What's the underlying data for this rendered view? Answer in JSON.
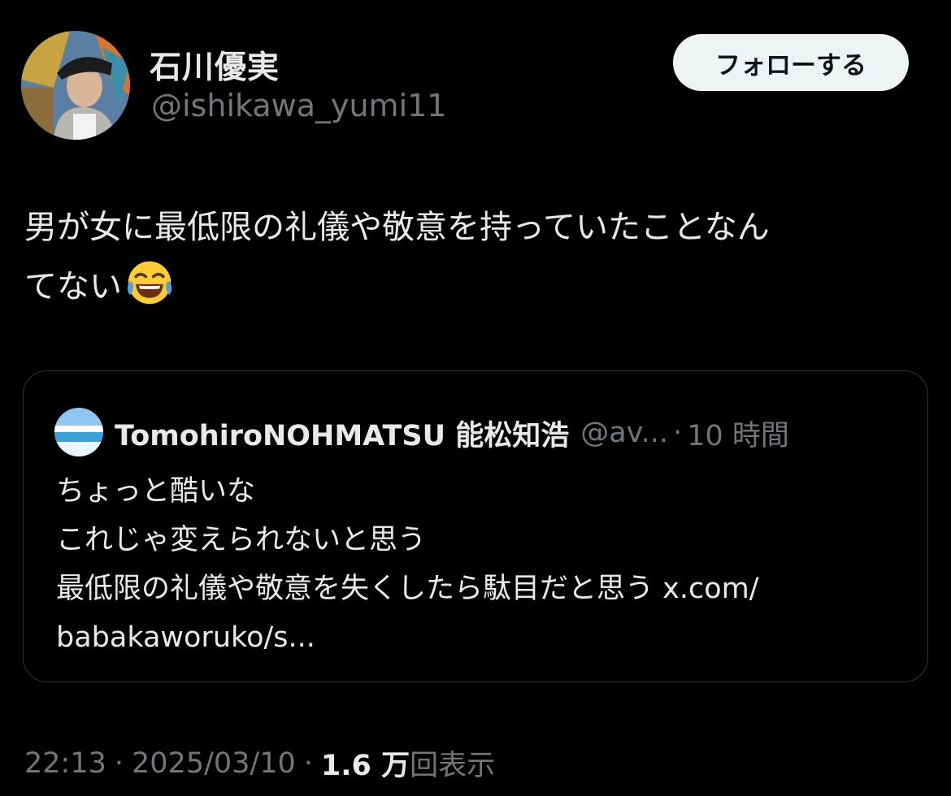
{
  "author": {
    "display_name": "石川優実",
    "handle": "@ishikawa_yumi11",
    "avatar_icon": "profile-photo-icon"
  },
  "follow_button": {
    "label": "フォローする"
  },
  "tweet": {
    "text": "男が女に最低限の礼儀や敬意を持っていたことなん\nてない",
    "emoji": "face-with-tears-of-joy-icon"
  },
  "quote": {
    "name": "TomohiroNOHMATSU 能松知浩",
    "handle": "@av...",
    "separator": "·",
    "time": "10 時間",
    "lines": [
      "ちょっと酷いな",
      "これじゃ変えられないと思う",
      "最低限の礼儀や敬意を失くしたら駄目だと思う x.com/",
      "babakaworuko/s..."
    ]
  },
  "meta": {
    "time": "22:13",
    "sep1": "·",
    "date": "2025/03/10",
    "sep2": "·",
    "views_count": "1.6 万",
    "views_label": "回表示"
  },
  "colors": {
    "background": "#000000",
    "primary_text": "#e7e9ea",
    "secondary_text": "#71767b",
    "border": "#2f3336",
    "button_bg": "#eff3f4"
  }
}
